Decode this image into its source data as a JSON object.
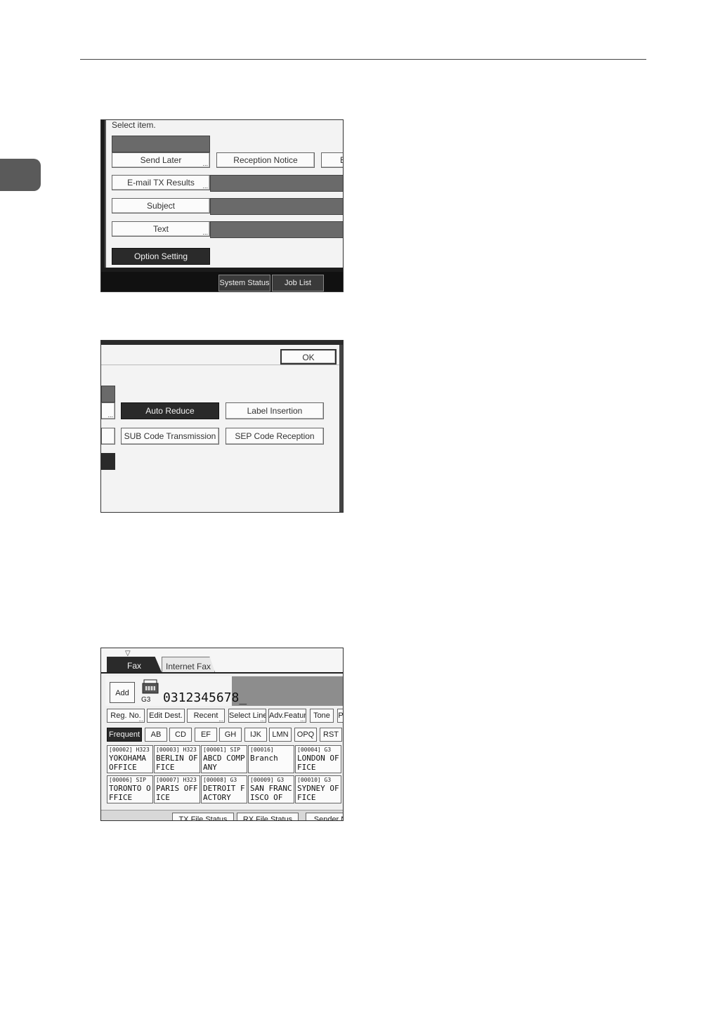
{
  "shot1": {
    "prompt": "Select item.",
    "buttons": {
      "send_later": "Send Later",
      "reception_notice": "Reception Notice",
      "cut_letter": "B",
      "email_tx_results": "E-mail TX Results",
      "subject": "Subject",
      "text": "Text",
      "option_setting": "Option Setting"
    },
    "footer": {
      "system_status": "System Status",
      "job_list": "Job List"
    }
  },
  "shot2": {
    "ok": "OK",
    "buttons": {
      "auto_reduce": "Auto Reduce",
      "label_insertion": "Label Insertion",
      "sub_code_transmission": "SUB Code Transmission",
      "sep_code_reception": "SEP Code Reception"
    }
  },
  "shot3": {
    "tabs": {
      "fax": "Fax",
      "internet_fax": "Internet Fax"
    },
    "add": "Add",
    "line": "G3",
    "fax_number": "0312345678_",
    "toolbar": [
      {
        "label": "Reg. No.",
        "dots": true
      },
      {
        "label": "Edit Dest.",
        "dots": false
      },
      {
        "label": "Recent",
        "dots": true
      },
      {
        "label": "Select Line",
        "dots": true
      },
      {
        "label": "Adv.Features",
        "dots": true
      },
      {
        "label": "Tone",
        "dots": false
      },
      {
        "label": "P",
        "dots": false
      }
    ],
    "index_tabs": [
      "Frequent",
      "AB",
      "CD",
      "EF",
      "GH",
      "IJK",
      "LMN",
      "OPQ",
      "RST"
    ],
    "destinations": [
      {
        "code": "[00002] H323",
        "name": "YOKOHAMA OFFICE"
      },
      {
        "code": "[00003] H323",
        "name": "BERLIN OFFICE"
      },
      {
        "code": "[00001] SIP",
        "name": "ABCD COMPANY"
      },
      {
        "code": "[00016] ",
        "name": "Branch"
      },
      {
        "code": "[00004] G3",
        "name": "LONDON OFFICE"
      },
      {
        "code": "[00006] SIP",
        "name": "TORONTO OFFICE"
      },
      {
        "code": "[00007] H323",
        "name": "PARIS OFFICE"
      },
      {
        "code": "[00008] G3",
        "name": "DETROIT FACTORY"
      },
      {
        "code": "[00009] G3",
        "name": "SAN FRANCISCO OF"
      },
      {
        "code": "[00010] G3",
        "name": "SYDNEY OFFICE"
      }
    ],
    "footer": [
      "TX File Status",
      "RX File Status",
      "Sender N"
    ]
  }
}
